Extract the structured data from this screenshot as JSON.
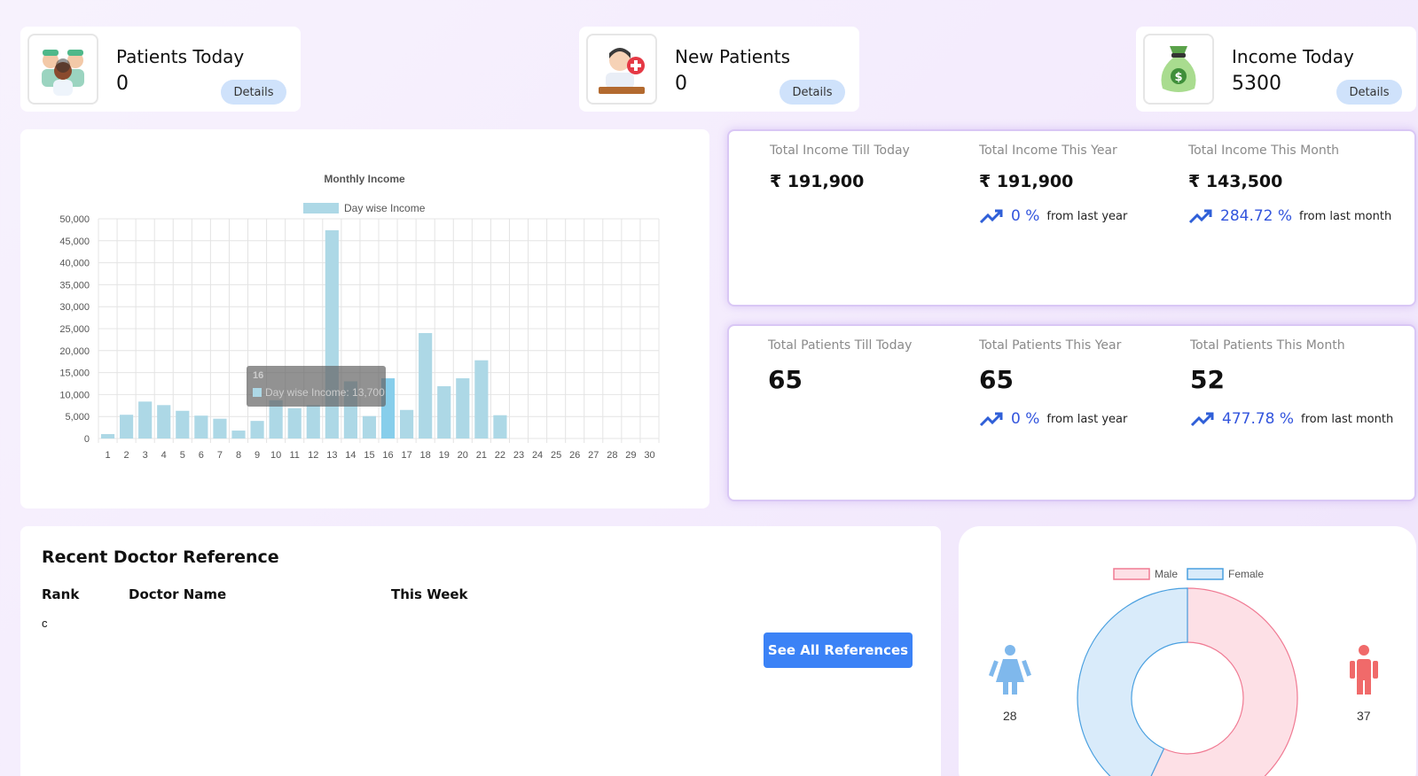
{
  "top_cards": [
    {
      "label": "Patients Today",
      "value": "0",
      "button": "Details",
      "icon": "doctors-group-icon"
    },
    {
      "label": "New Patients",
      "value": "0",
      "button": "Details",
      "icon": "doctor-desk-icon"
    },
    {
      "label": "Income Today",
      "value": "5300",
      "button": "Details",
      "icon": "money-bag-icon"
    }
  ],
  "income_summary": [
    {
      "label": "Total Income Till Today",
      "value": "₹ 191,900"
    },
    {
      "label": "Total Income This Year",
      "value": "₹ 191,900",
      "change": "0 %",
      "from": "from last year"
    },
    {
      "label": "Total Income This Month",
      "value": "₹ 143,500",
      "change": "284.72 %",
      "from": "from last month"
    }
  ],
  "patients_summary": [
    {
      "label": "Total Patients Till Today",
      "value": "65"
    },
    {
      "label": "Total Patients This Year",
      "value": "65",
      "change": "0 %",
      "from": "from last year"
    },
    {
      "label": "Total Patients This Month",
      "value": "52",
      "change": "477.78 %",
      "from": "from last month"
    }
  ],
  "doctor_reference": {
    "title": "Recent Doctor Reference",
    "columns": [
      "Rank",
      "Doctor Name",
      "This Week"
    ],
    "first_cell": "c",
    "button": "See All References"
  },
  "gender": {
    "legend": [
      "Male",
      "Female"
    ],
    "male_count": "37",
    "female_count": "28",
    "colors": {
      "male_fill": "#fde0e6",
      "male_stroke": "#f07a93",
      "female_fill": "#d9ebfa",
      "female_stroke": "#4aa0e0",
      "male_icon": "#f06a6a",
      "female_icon": "#7fb8ec"
    }
  },
  "chart_data": {
    "type": "bar",
    "title": "Monthly Income",
    "series_name": "Day wise Income",
    "categories": [
      "1",
      "2",
      "3",
      "4",
      "5",
      "6",
      "7",
      "8",
      "9",
      "10",
      "11",
      "12",
      "13",
      "14",
      "15",
      "16",
      "17",
      "18",
      "19",
      "20",
      "21",
      "22",
      "23",
      "24",
      "25",
      "26",
      "27",
      "28",
      "29",
      "30"
    ],
    "values": [
      1000,
      5400,
      8400,
      7600,
      6300,
      5200,
      4500,
      1800,
      4000,
      8700,
      6900,
      7600,
      47400,
      13000,
      5100,
      13700,
      6500,
      24000,
      11900,
      13700,
      17800,
      5300,
      0,
      0,
      0,
      0,
      0,
      0,
      0,
      0
    ],
    "ylim": [
      0,
      50000
    ],
    "yticks": [
      "0",
      "5,000",
      "10,000",
      "15,000",
      "20,000",
      "25,000",
      "30,000",
      "35,000",
      "40,000",
      "45,000",
      "50,000"
    ],
    "grid": true,
    "legend_position": "top",
    "bar_color": "#add8e6",
    "highlight_color": "#87ceeb",
    "tooltip": {
      "title": "16",
      "text": "Day wise Income: 13,700"
    }
  }
}
